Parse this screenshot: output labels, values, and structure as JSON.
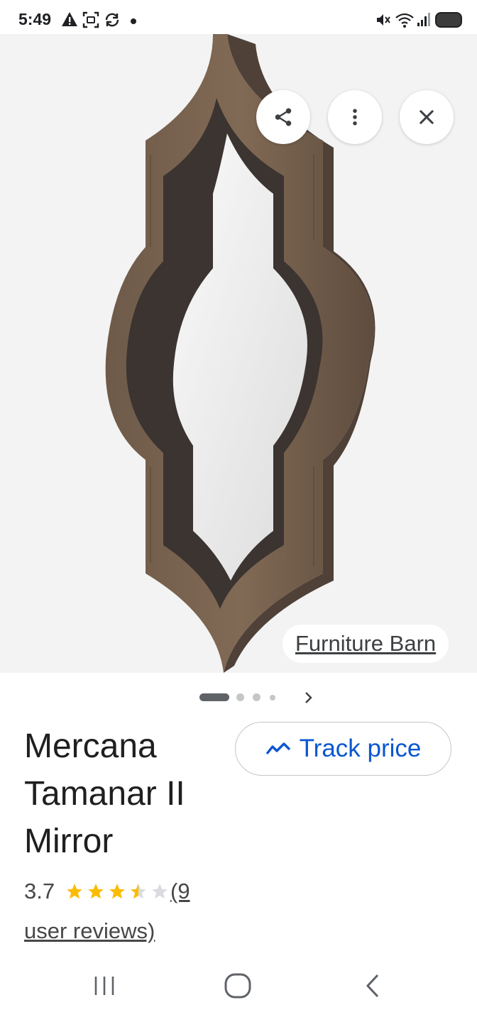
{
  "status_bar": {
    "time": "5:49",
    "left_icons": [
      "warning-icon",
      "screenshot-icon",
      "sync-icon",
      "notification-dot"
    ],
    "right_icons": [
      "mute-icon",
      "wifi-icon",
      "signal-icon",
      "battery-icon"
    ]
  },
  "image_viewer": {
    "actions": [
      {
        "name": "share-button",
        "icon": "share-icon"
      },
      {
        "name": "more-options-button",
        "icon": "more-vert-icon"
      },
      {
        "name": "close-button",
        "icon": "close-icon"
      }
    ],
    "source_label": "Furniture Barn",
    "carousel": {
      "total": 4,
      "active_index": 0
    }
  },
  "product": {
    "title": "Mercana Tamanar II Mirror",
    "rating": "3.7",
    "rating_value": 3.7,
    "rating_max": 5,
    "reviews_part1": "(9",
    "reviews_part2": "user reviews)",
    "track_price_label": "Track price"
  },
  "colors": {
    "accent": "#0b57d0",
    "star": "#fbbc04",
    "star_empty": "#dadce0",
    "wood_light": "#7a6552",
    "wood_dark": "#3d3632"
  },
  "nav_bar": {
    "items": [
      "recents-icon",
      "home-icon",
      "back-icon"
    ]
  }
}
